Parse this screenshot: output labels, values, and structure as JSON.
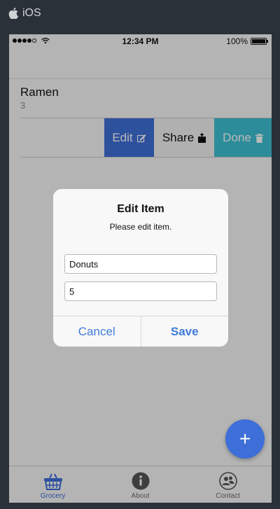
{
  "platform": {
    "label": "iOS"
  },
  "statusbar": {
    "time": "12:34 PM",
    "battery": "100%"
  },
  "list": {
    "item": {
      "name": "Ramen",
      "quantity": "3"
    },
    "actions": {
      "edit": "Edit",
      "share": "Share",
      "done": "Done"
    }
  },
  "dialog": {
    "title": "Edit Item",
    "message": "Please edit item.",
    "name_value": "Donuts",
    "quantity_value": "5",
    "cancel_label": "Cancel",
    "save_label": "Save"
  },
  "fab": {
    "label": "+"
  },
  "tabs": [
    {
      "label": "Grocery",
      "icon": "basket-icon",
      "active": true
    },
    {
      "label": "About",
      "icon": "info-icon",
      "active": false
    },
    {
      "label": "Contact",
      "icon": "contact-icon",
      "active": false
    }
  ],
  "colors": {
    "accent": "#3e6fd8",
    "done": "#3ec1d3",
    "chrome": "#2b3138"
  }
}
